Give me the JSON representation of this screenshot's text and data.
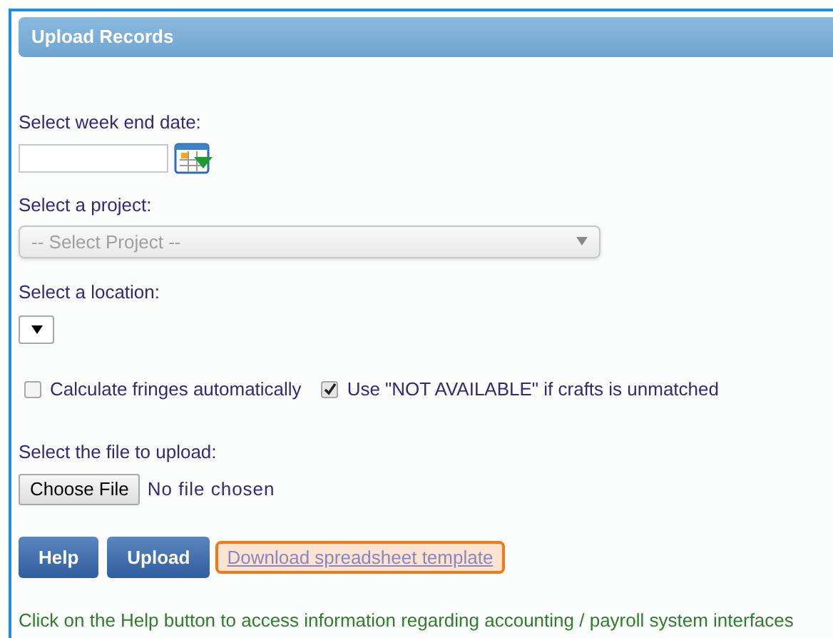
{
  "header": {
    "title": "Upload Records"
  },
  "week_end_date": {
    "label": "Select week end date:"
  },
  "project": {
    "label": "Select a project:",
    "placeholder": "-- Select Project --",
    "disabled": true
  },
  "location": {
    "label": "Select a location:"
  },
  "options": [
    {
      "label": "Calculate fringes automatically",
      "checked": false
    },
    {
      "label": "Use \"NOT AVAILABLE\" if crafts is unmatched",
      "checked": true
    }
  ],
  "file": {
    "label": "Select the file to upload:",
    "button": "Choose File",
    "status": "No file chosen"
  },
  "buttons": [
    "Help",
    "Upload"
  ],
  "template_link": {
    "label": "Download spreadsheet template",
    "highlighted": true
  },
  "help_text": "Click on the Help button to access information regarding accounting / payroll system interfaces"
}
